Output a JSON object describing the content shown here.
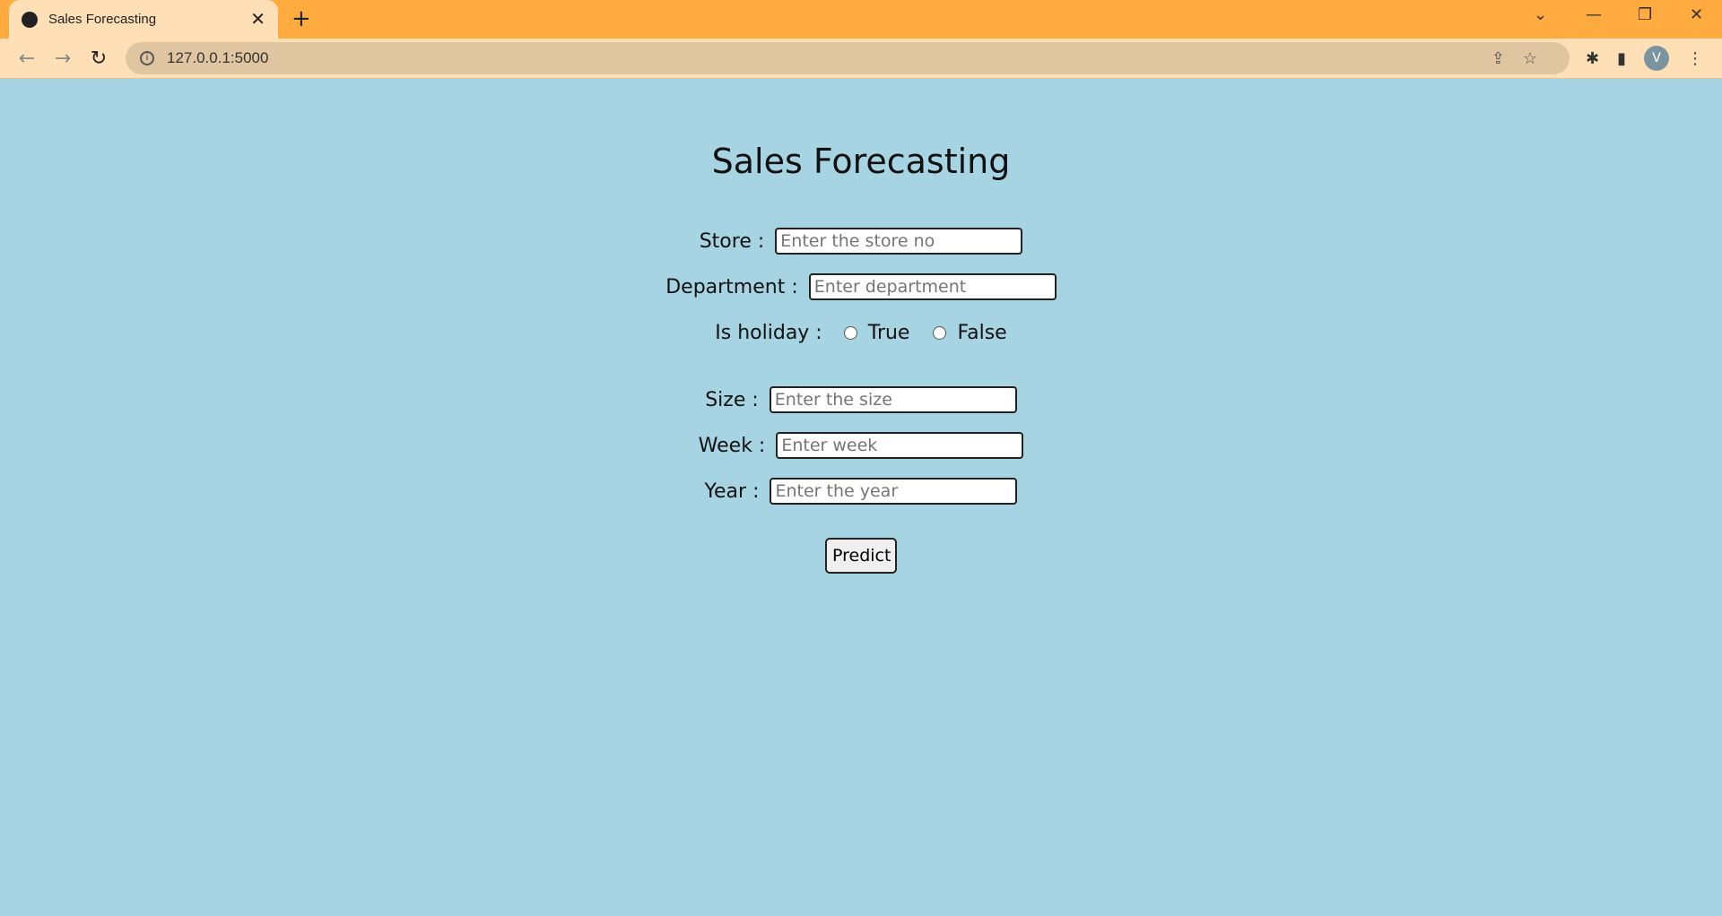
{
  "browser": {
    "tab_title": "Sales Forecasting",
    "url": "127.0.0.1:5000",
    "profile_initial": "V"
  },
  "page": {
    "title": "Sales Forecasting",
    "fields": [
      {
        "label": "Store :",
        "placeholder": "Enter the store no"
      },
      {
        "label": "Department :",
        "placeholder": "Enter department"
      },
      {
        "label": "Size :",
        "placeholder": "Enter the size"
      },
      {
        "label": "Week :",
        "placeholder": "Enter week"
      },
      {
        "label": "Year :",
        "placeholder": "Enter the year"
      }
    ],
    "holiday": {
      "label": "Is holiday :",
      "options": [
        "True",
        "False"
      ]
    },
    "submit_label": "Predict"
  }
}
